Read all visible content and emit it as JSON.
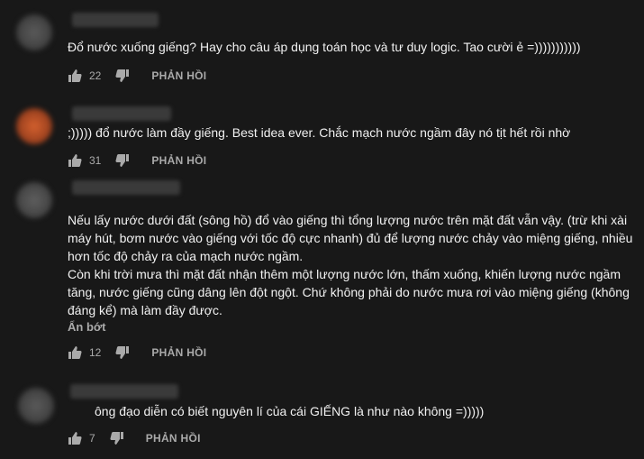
{
  "comments": [
    {
      "text": "Đổ nước xuống giếng? Hay cho câu áp dụng toán học và tư duy logic. Tao cười ẻ =)))))))))))",
      "likes": "22",
      "reply_label": "PHẢN HỒI"
    },
    {
      "text": ";))))) đổ nước làm đầy giếng. Best idea ever. Chắc mạch nước ngầm đây nó tịt hết rồi nhờ",
      "likes": "31",
      "reply_label": "PHẢN HỒI"
    },
    {
      "paragraphs": [
        "Nếu lấy nước dưới đất (sông hồ) đổ vào giếng thì tổng lượng nước trên mặt đất vẫn vậy. (trừ khi xài",
        "máy hút, bơm nước vào giếng với tốc độ cực nhanh) đủ để lượng nước chảy vào miệng giếng, nhiều",
        "hơn tốc độ chảy ra của mạch nước ngầm.",
        "Còn khi trời mưa thì mặt đất nhận thêm một lượng nước lớn, thấm xuống, khiến lượng nước ngầm",
        "tăng, nước giếng cũng dâng lên đột ngột. Chứ không phải do nước mưa rơi vào miệng giếng (không",
        "đáng kể) mà làm đầy được."
      ],
      "collapse_label": "Ẩn bớt",
      "likes": "12",
      "reply_label": "PHẢN HỒI"
    },
    {
      "text": "ông đạo diễn có biết nguyên lí của cái GIẾNG là như nào không =)))))",
      "likes": "7",
      "reply_label": "PHẢN HỒI"
    }
  ],
  "colors": {
    "background": "#181818",
    "text": "#f1f1f1",
    "secondary": "#aaaaaa"
  },
  "icons": [
    "thumb-up-icon",
    "thumb-down-icon"
  ]
}
